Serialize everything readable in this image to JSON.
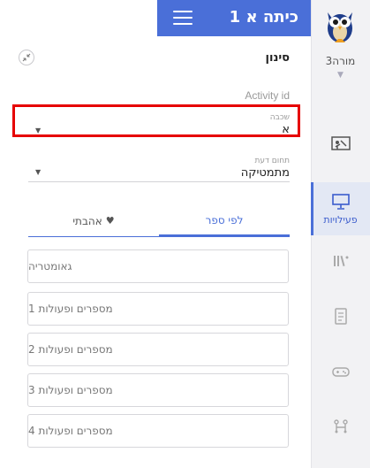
{
  "header": {
    "title": "כיתה א 1"
  },
  "filter": {
    "title": "סינון",
    "activity_id_label": "Activity id",
    "grade": {
      "label": "שכבה",
      "value": "א"
    },
    "subject": {
      "label": "תחום דעת",
      "value": "מתמטיקה"
    }
  },
  "tabs": {
    "by_book": "לפי ספר",
    "favorites": "אהבתי"
  },
  "books": [
    "גאומטריה",
    "מספרים ופעולות 1",
    "מספרים ופעולות 2",
    "מספרים ופעולות 3",
    "מספרים ופעולות 4"
  ],
  "sidebar": {
    "user_name": "מורה3",
    "activities_label": "פעילויות"
  },
  "colors": {
    "accent": "#4a6fd8",
    "highlight": "#e60000"
  }
}
